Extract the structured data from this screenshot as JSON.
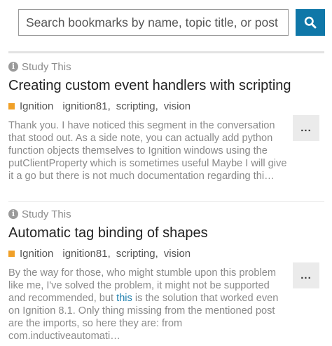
{
  "search": {
    "placeholder": "Search bookmarks by name, topic title, or post content",
    "button_icon": "search-icon"
  },
  "bookmarks": [
    {
      "meta_icon": "info-icon",
      "label": "Study This",
      "title": "Creating custom event handlers with scripting",
      "category": "Ignition",
      "category_color": "#f0a028",
      "tags": [
        "ignition81",
        "scripting",
        "vision"
      ],
      "excerpt": "Thank you. I have noticed this segment in the conversation that stood out. As a side note, you can actually add python function objects themselves to Ignition windows using the putClientProperty which is sometimes useful Maybe I will give it a go but there is not much documentation regarding thi…",
      "more_label": "..."
    },
    {
      "meta_icon": "info-icon",
      "label": "Study This",
      "title": "Automatic tag binding of shapes",
      "category": "Ignition",
      "category_color": "#f0a028",
      "tags": [
        "ignition81",
        "scripting",
        "vision"
      ],
      "excerpt_before": "By the way for those, who might stumble upon this problem like me, I've solved the problem, it might not be supported and recommended, but ",
      "excerpt_link": "this",
      "excerpt_after": " is the solution that worked even on Ignition 8.1. Only thing missing from the mentioned post are the imports, so here they are: from com.inductiveautomati…",
      "more_label": "..."
    }
  ],
  "colors": {
    "accent": "#0f77a8",
    "link": "#1f7fae",
    "muted_text": "#8a8a8a"
  }
}
